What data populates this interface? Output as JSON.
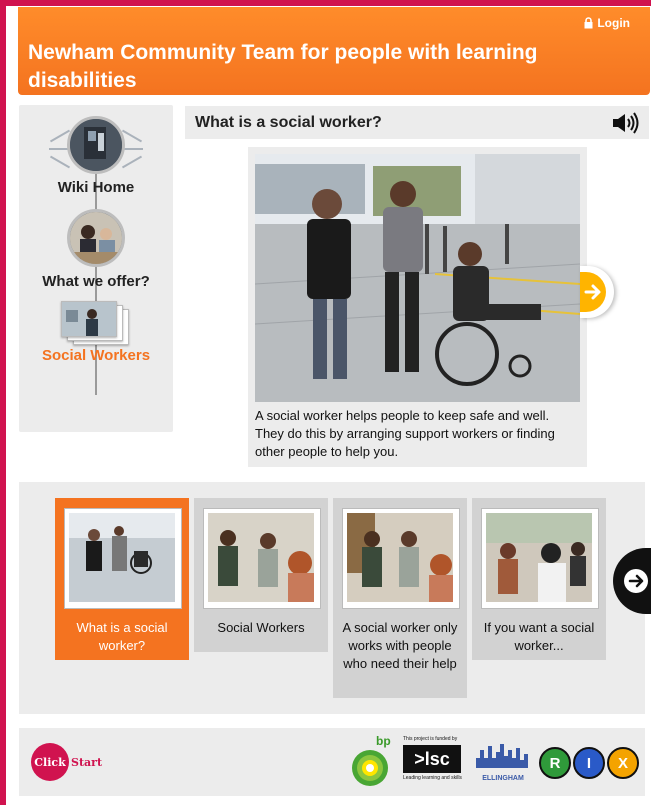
{
  "header": {
    "title": "Newham Community Team for people with learning disabilities",
    "login_label": "Login"
  },
  "sidebar": {
    "items": [
      {
        "label": "Wiki Home",
        "active": false
      },
      {
        "label": "What we offer?",
        "active": false
      },
      {
        "label": "Social Workers",
        "active": true
      }
    ]
  },
  "main": {
    "heading": "What is a social worker?",
    "caption": "A social worker helps people to keep safe and well. They do this by arranging support workers or finding other people to help you."
  },
  "carousel": {
    "tiles": [
      {
        "label": "What is a social worker?",
        "active": true
      },
      {
        "label": "Social Workers",
        "active": false
      },
      {
        "label": "A social worker only works with people who need their help",
        "active": false
      },
      {
        "label": "If you want a social worker...",
        "active": false
      }
    ]
  },
  "footer": {
    "clickstart_circle": "Click",
    "clickstart_text": "Start",
    "bp_label": "bp",
    "lsc_small": "This project is funded by",
    "lsc_logo": ">lsc",
    "lsc_tagline": "Leading learning and skills",
    "ellingham_label": "ELLINGHAM",
    "rix_letters": [
      "R",
      "I",
      "X"
    ]
  },
  "colors": {
    "accent": "#f47320",
    "frame": "#d0134f",
    "panel": "#ececec",
    "arrow": "#ffb400"
  },
  "icons": [
    "lock-icon",
    "speaker-icon",
    "next-arrow-icon",
    "carousel-next-icon"
  ]
}
